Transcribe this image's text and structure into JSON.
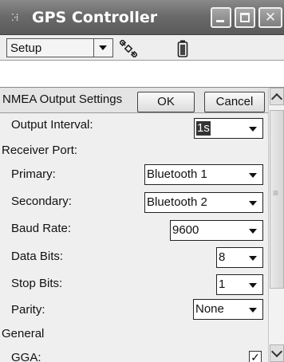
{
  "window": {
    "title": "GPS Controller",
    "title_icon": "gps-app-icon"
  },
  "toolbar": {
    "menu_label": "Setup",
    "icons": [
      "satellite-icon",
      "battery-icon"
    ]
  },
  "pane": {
    "title": "NMEA Output Settings",
    "ok_label": "OK",
    "cancel_label": "Cancel"
  },
  "settings": {
    "output_interval": {
      "label": "Output Interval:",
      "value": "1s"
    },
    "receiver_port_heading": "Receiver Port:",
    "primary": {
      "label": "Primary:",
      "value": "Bluetooth 1"
    },
    "secondary": {
      "label": "Secondary:",
      "value": "Bluetooth 2"
    },
    "baud_rate": {
      "label": "Baud Rate:",
      "value": "9600"
    },
    "data_bits": {
      "label": "Data Bits:",
      "value": "8"
    },
    "stop_bits": {
      "label": "Stop Bits:",
      "value": "1"
    },
    "parity": {
      "label": "Parity:",
      "value": "None"
    },
    "general_heading": "General",
    "gga": {
      "label": "GGA:",
      "checked": true,
      "mark": "✓"
    }
  }
}
